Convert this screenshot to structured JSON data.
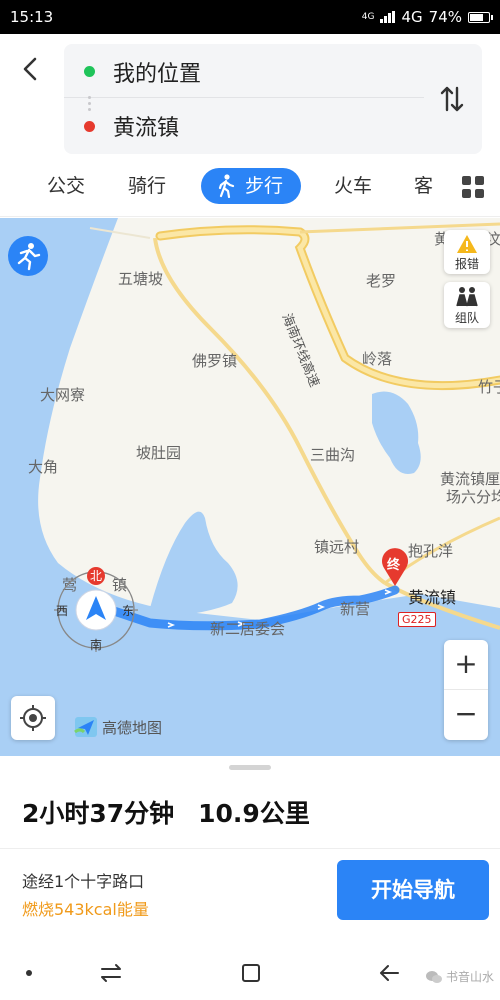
{
  "status_bar": {
    "time": "15:13",
    "network_small": "4G",
    "network": "4G",
    "battery": "74%",
    "battery_level": 0.74
  },
  "route": {
    "from": "我的位置",
    "to": "黄流镇"
  },
  "mode_tabs": [
    {
      "label": "公交",
      "active": false
    },
    {
      "label": "骑行",
      "active": false
    },
    {
      "label": "步行",
      "active": true
    },
    {
      "label": "火车",
      "active": false
    },
    {
      "label": "客",
      "active": false
    }
  ],
  "map": {
    "labels": {
      "wutangpo": "五塘坡",
      "laoluo": "老罗",
      "foluozhen": "佛罗镇",
      "lingluo": "岭落",
      "dawangchai": "大网寮",
      "podubuyuan": "坡肚园",
      "sanqugou": "三曲沟",
      "dajiao": "大角",
      "zhenyuancun": "镇远村",
      "baokongyang": "抱孔洋",
      "huangliu": "黄流镇",
      "xinying": "新营",
      "xiner": "新二居委会",
      "huangliu_farm_1": "黄流镇厘",
      "huangliu_farm_2": "场六分均",
      "zhuzi": "竹子",
      "huang_top": "黄",
      "wen_top": "汶",
      "yingge": "莺",
      "yingge_zhen": "镇",
      "highway_name": "海南环线高速",
      "road_code": "G225"
    },
    "compass": {
      "north": "北",
      "west": "西",
      "east": "东",
      "south": "南"
    },
    "end_marker": "终",
    "report_label": "报错",
    "team_label": "组队",
    "zoom_in": "+",
    "zoom_out": "−",
    "brand": "高德地图"
  },
  "summary": {
    "duration": "2小时37分钟",
    "distance": "10.9公里",
    "via": "途经1个十字路口",
    "calories": "燃烧543kcal能量"
  },
  "start_button": "开始导航",
  "watermark": "书音山水",
  "colors": {
    "accent": "#2b84f6",
    "calorie": "#f09a1a",
    "origin_dot": "#1fc45a",
    "destination_dot": "#e63a2e"
  }
}
